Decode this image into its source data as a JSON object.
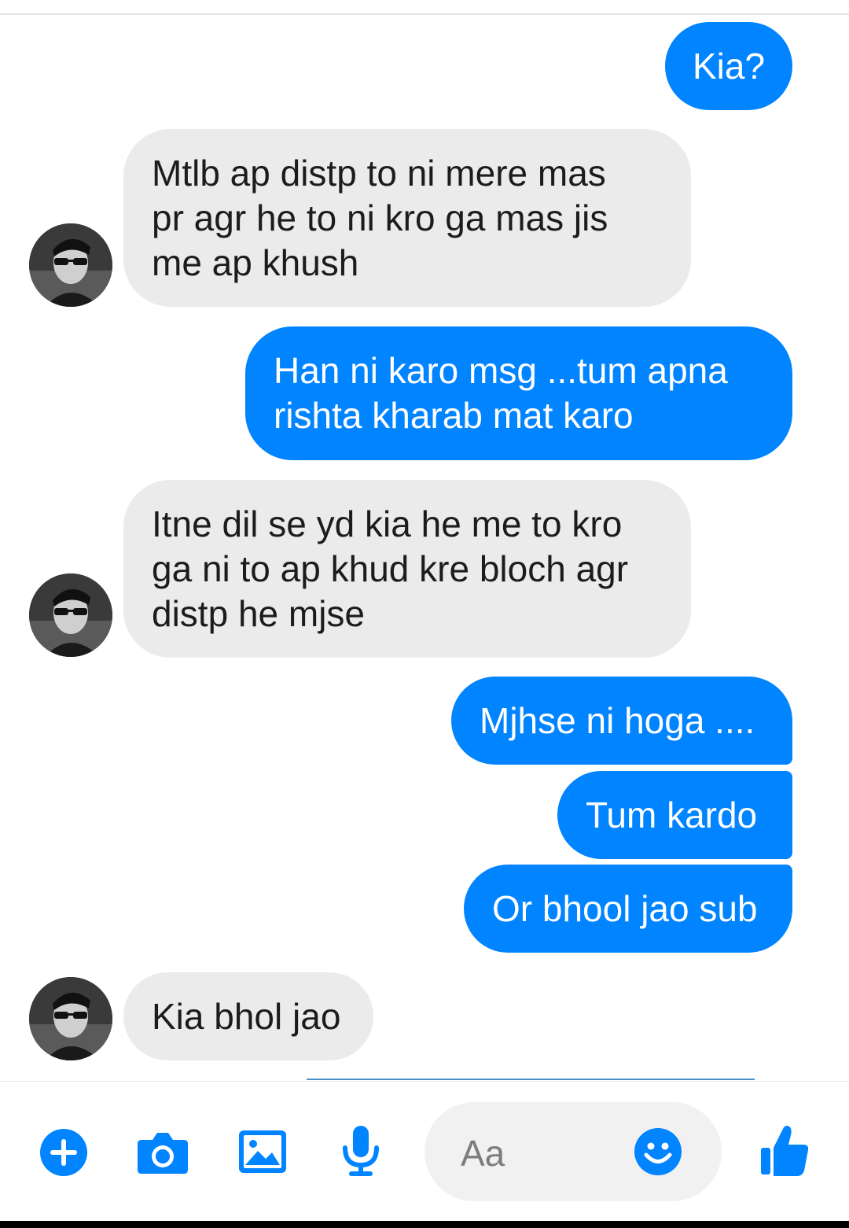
{
  "theme": {
    "accent": "#0084ff",
    "incoming_bg": "#ebebeb"
  },
  "messages": [
    {
      "direction": "outgoing",
      "text": "Kia?"
    },
    {
      "direction": "incoming",
      "text": "Mtlb ap distp to ni mere mas\npr agr he to ni kro ga mas jis\nme ap khush"
    },
    {
      "direction": "outgoing",
      "text": "Han ni karo msg ...tum apna\nrishta kharab mat karo"
    },
    {
      "direction": "incoming",
      "text": "Itne dil se yd kia he me to kro\nga ni to ap khud kre bloch agr\ndistp he mjse"
    },
    {
      "direction": "outgoing",
      "text": "Mjhse ni hoga ...."
    },
    {
      "direction": "outgoing",
      "text": "Tum kardo"
    },
    {
      "direction": "outgoing",
      "text": "Or bhool jao sub"
    },
    {
      "direction": "incoming",
      "text": "Kia bhol jao"
    }
  ],
  "composer": {
    "placeholder": "Aa",
    "icons": [
      "plus-icon",
      "camera-icon",
      "image-icon",
      "microphone-icon",
      "emoji-icon",
      "thumbs-up-icon"
    ]
  }
}
